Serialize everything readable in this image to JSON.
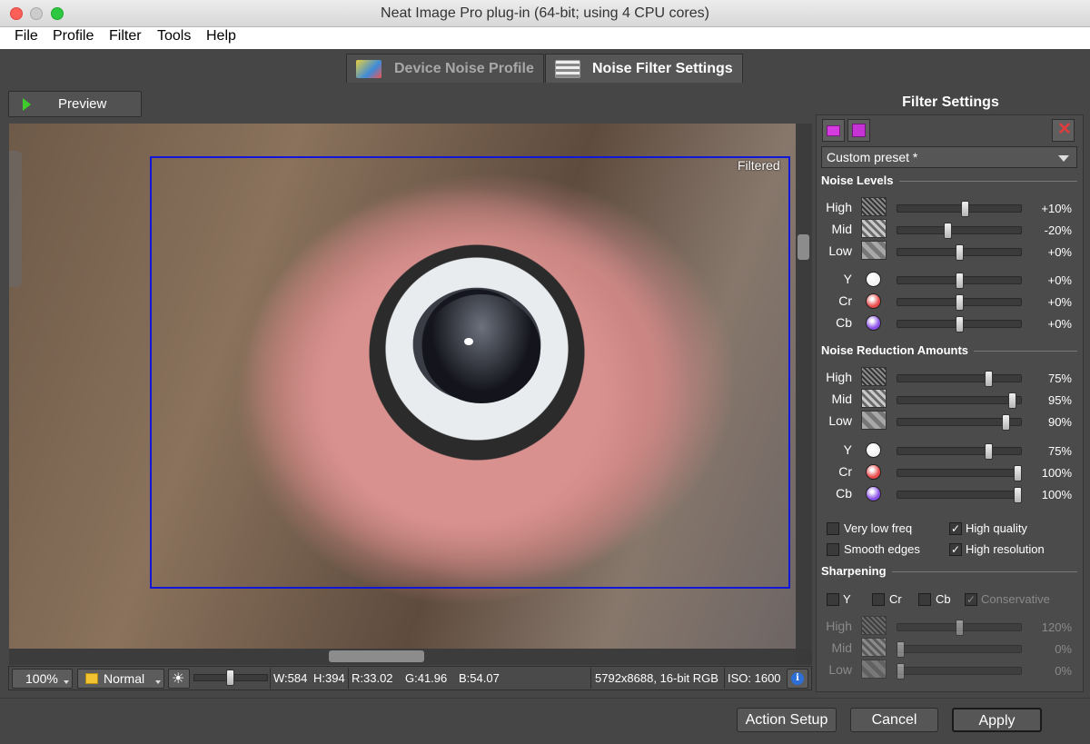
{
  "window": {
    "title": "Neat Image Pro plug-in (64-bit; using 4 CPU cores)"
  },
  "menu": [
    "File",
    "Profile",
    "Filter",
    "Tools",
    "Help"
  ],
  "tabs": [
    {
      "label": "Device Noise Profile",
      "active": false,
      "icon": "profile-icon"
    },
    {
      "label": "Noise Filter Settings",
      "active": true,
      "icon": "sliders-icon"
    }
  ],
  "preview": {
    "label": "Preview",
    "overlay_label": "Filtered"
  },
  "status": {
    "zoom": "100%",
    "mode": "Normal",
    "brightness_level": 0.48,
    "width": "W:584",
    "height": "H:394",
    "r": "R:33.02",
    "g": "G:41.96",
    "b": "B:54.07",
    "image_info": "5792x8688, 16-bit RGB",
    "iso": "ISO: 1600"
  },
  "panel": {
    "title": "Filter Settings",
    "preset": "Custom preset *",
    "noise_levels": {
      "heading": "Noise Levels",
      "rows": [
        {
          "label": "High",
          "value": "+10%",
          "level": 0.55
        },
        {
          "label": "Mid",
          "value": "-20%",
          "level": 0.4
        },
        {
          "label": "Low",
          "value": "+0%",
          "level": 0.5
        },
        {
          "label": "Y",
          "value": "+0%",
          "level": 0.5,
          "color": "#f2f2f2"
        },
        {
          "label": "Cr",
          "value": "+0%",
          "level": 0.5,
          "color": "#e84a4a"
        },
        {
          "label": "Cb",
          "value": "+0%",
          "level": 0.5,
          "color": "#8a52e8"
        }
      ]
    },
    "reduction": {
      "heading": "Noise Reduction Amounts",
      "rows": [
        {
          "label": "High",
          "value": "75%",
          "level": 0.75
        },
        {
          "label": "Mid",
          "value": "95%",
          "level": 0.95
        },
        {
          "label": "Low",
          "value": "90%",
          "level": 0.9
        },
        {
          "label": "Y",
          "value": "75%",
          "level": 0.75,
          "color": "#f2f2f2"
        },
        {
          "label": "Cr",
          "value": "100%",
          "level": 1.0,
          "color": "#e84a4a"
        },
        {
          "label": "Cb",
          "value": "100%",
          "level": 1.0,
          "color": "#8a52e8"
        }
      ]
    },
    "options": [
      {
        "label": "Very low freq",
        "checked": false
      },
      {
        "label": "High quality",
        "checked": true
      },
      {
        "label": "Smooth edges",
        "checked": false
      },
      {
        "label": "High resolution",
        "checked": true
      }
    ],
    "sharpening": {
      "heading": "Sharpening",
      "channels": [
        {
          "label": "Y",
          "checked": false
        },
        {
          "label": "Cr",
          "checked": false
        },
        {
          "label": "Cb",
          "checked": false
        },
        {
          "label": "Conservative",
          "checked": true
        }
      ],
      "rows": [
        {
          "label": "High",
          "value": "120%",
          "level": 0.5
        },
        {
          "label": "Mid",
          "value": "0%",
          "level": 0.0
        },
        {
          "label": "Low",
          "value": "0%",
          "level": 0.0
        }
      ]
    }
  },
  "buttons": {
    "action_setup": "Action Setup",
    "cancel": "Cancel",
    "apply": "Apply"
  }
}
